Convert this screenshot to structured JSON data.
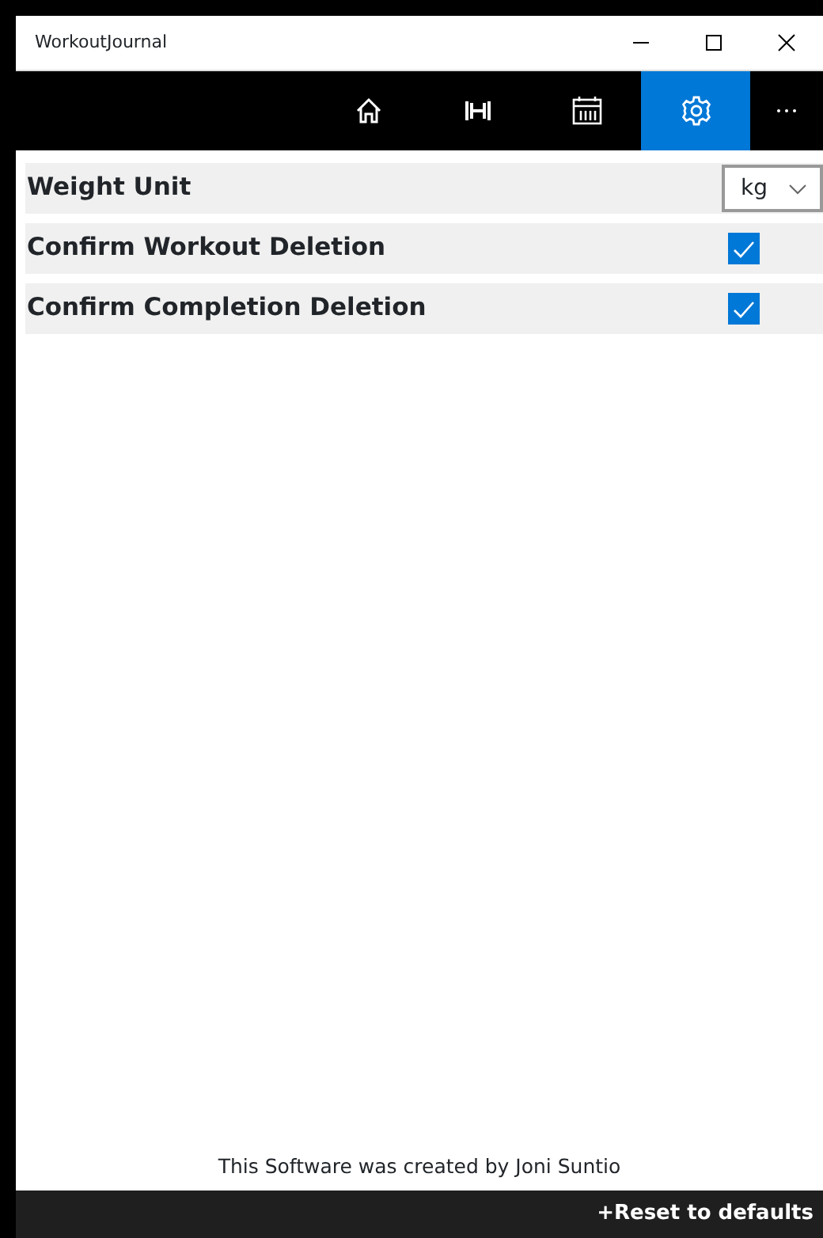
{
  "window": {
    "title": "WorkoutJournal"
  },
  "nav": [
    {
      "kind": "home",
      "selected": false
    },
    {
      "kind": "dumbbell",
      "selected": false
    },
    {
      "kind": "calendar",
      "selected": false
    },
    {
      "kind": "settings",
      "selected": true
    },
    {
      "kind": "more",
      "selected": false
    }
  ],
  "settings": [
    {
      "kind": "dropdown",
      "label": "Weight Unit",
      "value": "kg"
    },
    {
      "kind": "checkbox",
      "label": "Confirm Workout Deletion",
      "checked": true
    },
    {
      "kind": "checkbox",
      "label": "Confirm Completion Deletion",
      "checked": true
    }
  ],
  "footer": {
    "credit": "This Software was created by Joni Suntio",
    "reset": "+Reset to defaults"
  }
}
